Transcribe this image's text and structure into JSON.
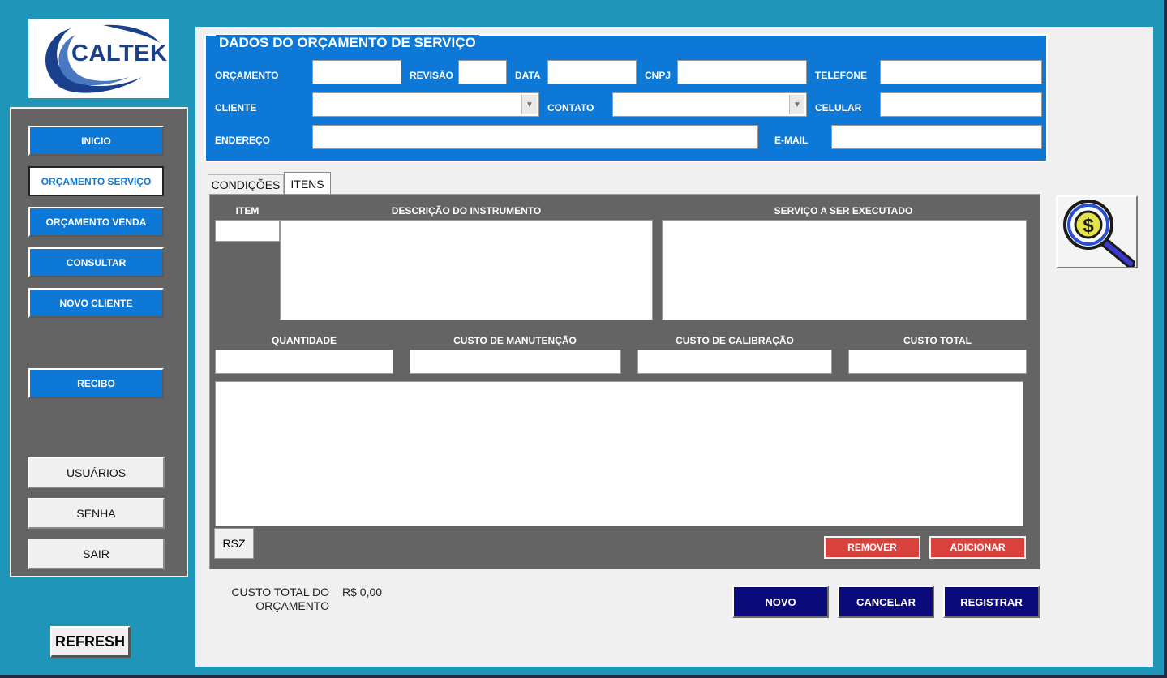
{
  "brand": {
    "logo_text": "CALTEK"
  },
  "sidebar": {
    "items": [
      {
        "label": "INICIO"
      },
      {
        "label": "ORÇAMENTO SERVIÇO"
      },
      {
        "label": "ORÇAMENTO VENDA"
      },
      {
        "label": "CONSULTAR"
      },
      {
        "label": "NOVO CLIENTE"
      },
      {
        "label": "RECIBO"
      }
    ],
    "active_item": "ORÇAMENTO SERVIÇO",
    "bottom": [
      {
        "label": "USUÁRIOS"
      },
      {
        "label": "SENHA"
      },
      {
        "label": "SAIR"
      }
    ]
  },
  "refresh_label": "REFRESH",
  "header": {
    "title": "DADOS DO ORÇAMENTO DE SERVIÇO",
    "labels": {
      "orcamento": "ORÇAMENTO",
      "revisao": "REVISÃO",
      "data": "DATA",
      "cnpj": "CNPJ",
      "telefone": "TELEFONE",
      "cliente": "CLIENTE",
      "contato": "CONTATO",
      "celular": "CELULAR",
      "endereco": "ENDEREÇO",
      "email": "E-MAIL"
    },
    "values": {
      "orcamento": "",
      "revisao": "",
      "data": "",
      "cnpj": "",
      "telefone": "",
      "cliente": "",
      "contato": "",
      "celular": "",
      "endereco": "",
      "email": ""
    }
  },
  "tabs": [
    {
      "label": "CONDIÇÕES"
    },
    {
      "label": "ITENS"
    }
  ],
  "active_tab": "ITENS",
  "items_panel": {
    "labels": {
      "item": "ITEM",
      "descricao": "DESCRIÇÃO DO INSTRUMENTO",
      "servico": "SERVIÇO A SER EXECUTADO",
      "quantidade": "QUANTIDADE",
      "custo_manutencao": "CUSTO DE MANUTENÇÃO",
      "custo_calibracao": "CUSTO DE CALIBRAÇÃO",
      "custo_total": "CUSTO TOTAL"
    },
    "rsz_label": "RSZ",
    "remover_label": "REMOVER",
    "adicionar_label": "ADICIONAR"
  },
  "footer": {
    "total_label": "CUSTO TOTAL DO ORÇAMENTO",
    "total_value": "R$ 0,00",
    "novo_label": "NOVO",
    "cancelar_label": "CANCELAR",
    "registrar_label": "REGISTRAR"
  },
  "icons": {
    "search_button": "money-search-icon",
    "combo_arrow": "chevron-down-icon"
  },
  "colors": {
    "frame": "#1f95b9",
    "sidebar": "#646464",
    "primary": "#0d78d6",
    "danger": "#d9423c",
    "navy": "#0b0a7a"
  }
}
